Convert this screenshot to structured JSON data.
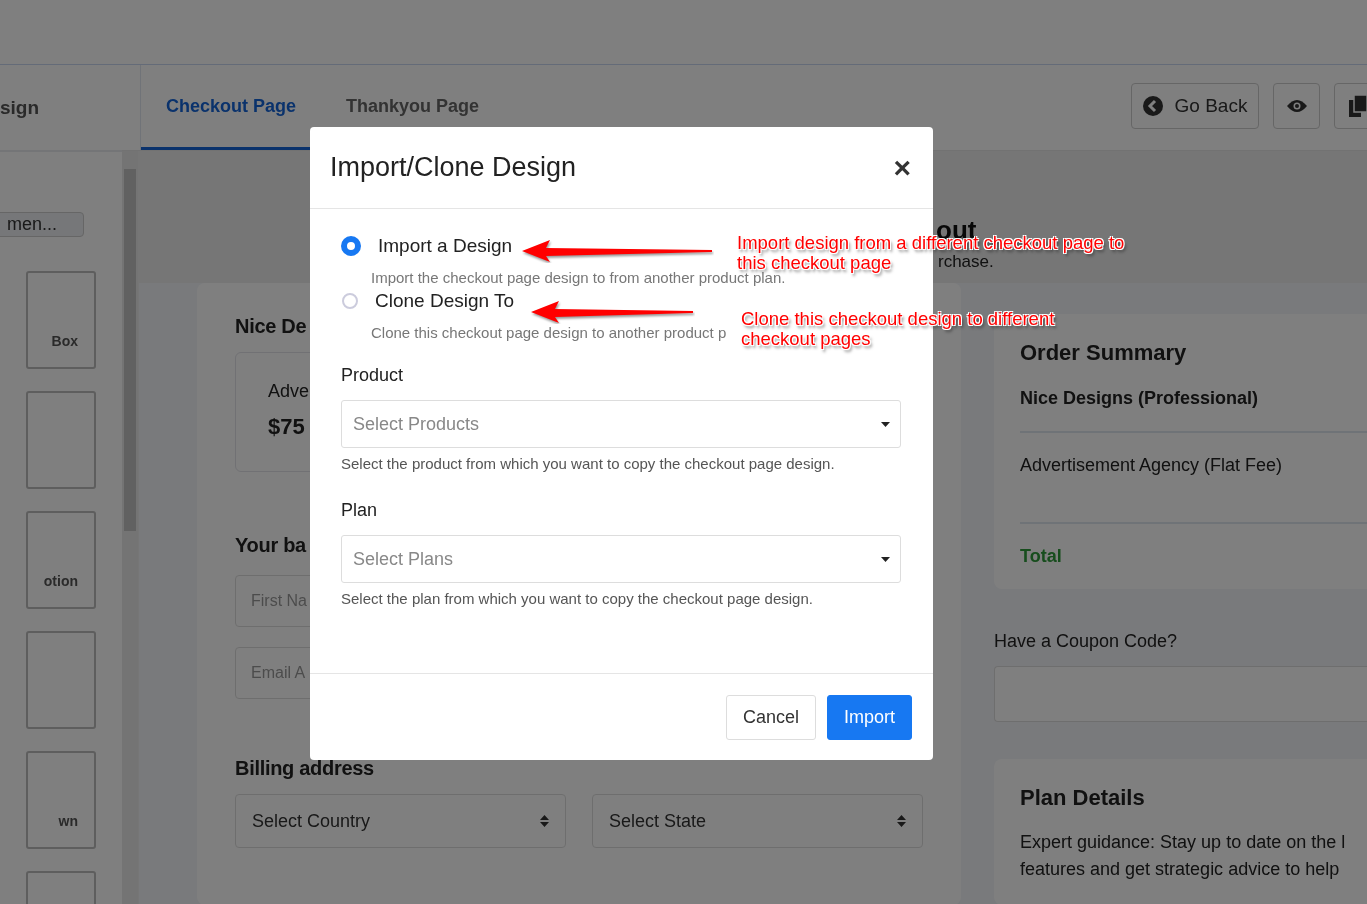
{
  "header": {
    "sidebar_title": "sign",
    "tabs": [
      {
        "label": "Checkout Page",
        "selected": true
      },
      {
        "label": "Thankyou Page",
        "selected": false
      }
    ],
    "go_back": "Go Back"
  },
  "sidebar": {
    "button": "men...",
    "tiles": [
      {
        "kind": "labeled",
        "label": "Box"
      },
      {
        "kind": "blank"
      },
      {
        "kind": "labeled",
        "label": "otion"
      },
      {
        "kind": "blank"
      },
      {
        "kind": "labeled",
        "label": "wn"
      },
      {
        "kind": "blank"
      }
    ]
  },
  "banner": {
    "title": "out",
    "subtitle": "rchase."
  },
  "checkout_form": {
    "title": "Nice De",
    "product_name": "Adve",
    "price": "$75",
    "section_title": "Your ba",
    "fields": [
      {
        "placeholder": "First Na"
      },
      {
        "placeholder": "Email A"
      }
    ],
    "billing_title": "Billing address",
    "selects": [
      "Select Country",
      "Select State"
    ]
  },
  "order_summary": {
    "title": "Order Summary",
    "items": [
      "Nice Designs (Professional)",
      "Advertisement Agency (Flat Fee)"
    ],
    "total_label": "Total"
  },
  "coupon": {
    "label": "Have a Coupon Code?"
  },
  "plan_details": {
    "title": "Plan Details",
    "lines": [
      "Expert guidance: Stay up to date on the l",
      "features and get strategic advice to help"
    ]
  },
  "dialog": {
    "title": "Import/Clone Design",
    "close": "×",
    "options": [
      {
        "label": "Import a Design",
        "description": "Import the checkout page design to from another product plan.",
        "selected": true
      },
      {
        "label": "Clone Design To",
        "description": "Clone this checkout page design to another product p",
        "selected": false
      }
    ],
    "fields": [
      {
        "label": "Product",
        "placeholder": "Select Products",
        "help": "Select the product from which you want to copy the checkout page design."
      },
      {
        "label": "Plan",
        "placeholder": "Select Plans",
        "help": "Select the plan from which you want to copy the checkout page design."
      }
    ],
    "buttons": [
      {
        "label": "Cancel",
        "kind": "secondary"
      },
      {
        "label": "Import",
        "kind": "primary"
      }
    ]
  },
  "annotations": [
    {
      "lines": [
        "Import design from a different checkout page to",
        "this checkout page"
      ]
    },
    {
      "lines": [
        "Clone this checkout design to different",
        "checkout pages"
      ]
    }
  ]
}
